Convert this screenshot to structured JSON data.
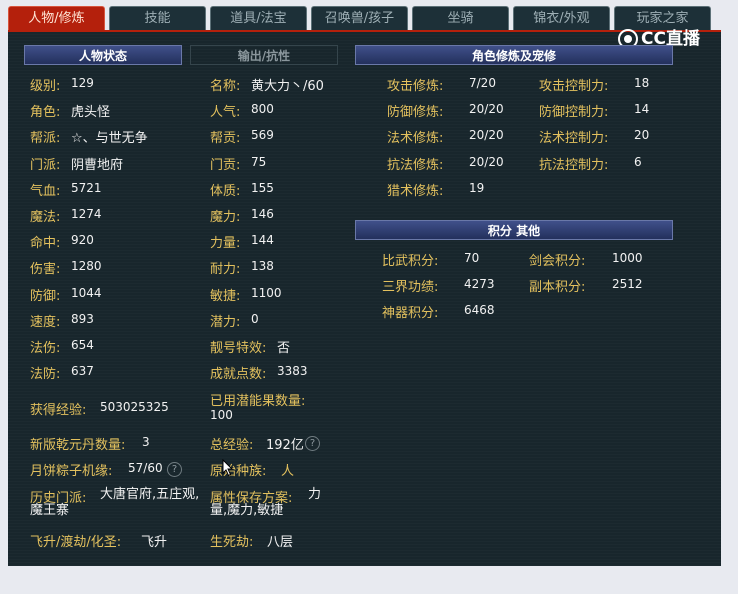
{
  "tabs": [
    "人物/修炼",
    "技能",
    "道具/法宝",
    "召唤兽/孩子",
    "坐骑",
    "锦衣/外观",
    "玩家之家"
  ],
  "logo_text": "CC直播",
  "left_headers": {
    "status": "人物状态",
    "output": "输出/抗性"
  },
  "left_col1": [
    {
      "label": "级别:",
      "value": "129"
    },
    {
      "label": "角色:",
      "value": "虎头怪"
    },
    {
      "label": "帮派:",
      "value": "☆、与世无争"
    },
    {
      "label": "门派:",
      "value": "阴曹地府"
    },
    {
      "label": "气血:",
      "value": "5721"
    },
    {
      "label": "魔法:",
      "value": "1274"
    },
    {
      "label": "命中:",
      "value": "920"
    },
    {
      "label": "伤害:",
      "value": "1280"
    },
    {
      "label": "防御:",
      "value": "1044"
    },
    {
      "label": "速度:",
      "value": "893"
    },
    {
      "label": "法伤:",
      "value": "654"
    },
    {
      "label": "法防:",
      "value": "637"
    }
  ],
  "left_col2": [
    {
      "label": "名称:",
      "value": "黄大力丶/60"
    },
    {
      "label": "人气:",
      "value": "800"
    },
    {
      "label": "帮贡:",
      "value": "569"
    },
    {
      "label": "门贡:",
      "value": "75"
    },
    {
      "label": "体质:",
      "value": "155"
    },
    {
      "label": "魔力:",
      "value": "146"
    },
    {
      "label": "力量:",
      "value": "144"
    },
    {
      "label": "耐力:",
      "value": "138"
    },
    {
      "label": "敏捷:",
      "value": "1100"
    },
    {
      "label": "潜力:",
      "value": "0"
    },
    {
      "label": "靓号特效:",
      "value": "否"
    },
    {
      "label": "成就点数:",
      "value": "3383"
    }
  ],
  "extra": {
    "exp_label": "获得经验:",
    "exp_value": "503025325",
    "potion_label": "已用潜能果数量:",
    "potion_value": "100",
    "qianyuan_label": "新版乾元丹数量:",
    "qianyuan_value": "3",
    "total_exp_label": "总经验:",
    "total_exp_value": "192亿",
    "mooncake_label": "月饼粽子机缘:",
    "mooncake_value": "57/60",
    "race_label": "原始种族:",
    "race_value": "人",
    "history_label": "历史门派:",
    "history_value": "大唐官府,五庄观,魔王寨",
    "save_label": "属性保存方案:",
    "save_value": "力量,魔力,敏捷",
    "ascend_label": "飞升/渡劫/化圣:",
    "ascend_value": "飞升",
    "life_label": "生死劫:",
    "life_value": "八层"
  },
  "cultivation": {
    "header": "角色修炼及宠修",
    "rows": [
      {
        "label": "攻击修炼:",
        "value": "7/20"
      },
      {
        "label": "防御修炼:",
        "value": "20/20"
      },
      {
        "label": "法术修炼:",
        "value": "20/20"
      },
      {
        "label": "抗法修炼:",
        "value": "20/20"
      },
      {
        "label": "猎术修炼:",
        "value": "19"
      }
    ],
    "control": [
      {
        "label": "攻击控制力:",
        "value": "18"
      },
      {
        "label": "防御控制力:",
        "value": "14"
      },
      {
        "label": "法术控制力:",
        "value": "20"
      },
      {
        "label": "抗法控制力:",
        "value": "6"
      }
    ]
  },
  "scores": {
    "header": "积分 其他",
    "rows": [
      {
        "label": "比武积分:",
        "value": "70"
      },
      {
        "label": "三界功绩:",
        "value": "4273"
      },
      {
        "label": "神器积分:",
        "value": "6468"
      }
    ],
    "col2": [
      {
        "label": "剑会积分:",
        "value": "1000"
      },
      {
        "label": "副本积分:",
        "value": "2512"
      }
    ]
  }
}
